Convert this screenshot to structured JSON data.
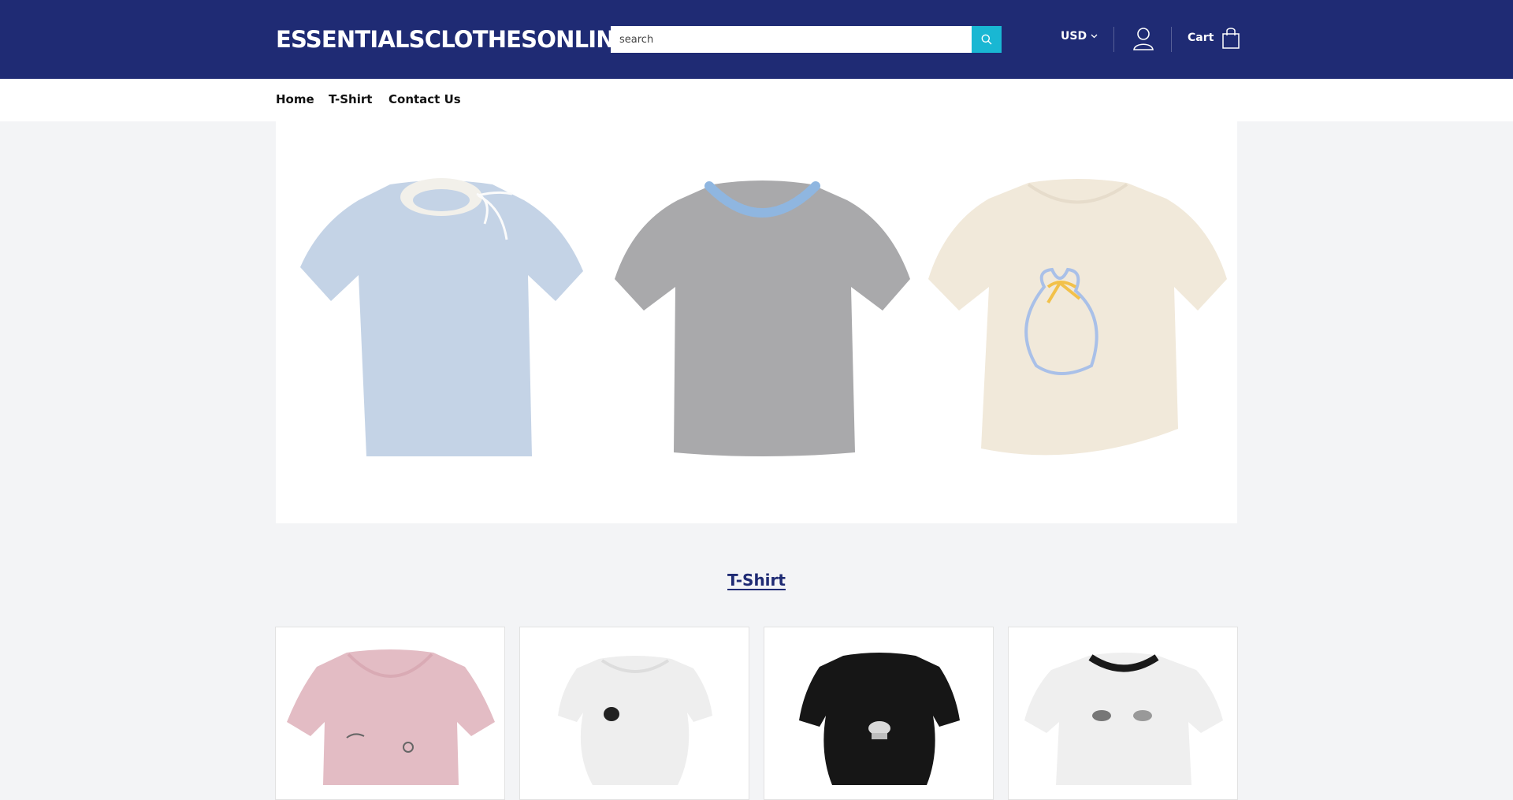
{
  "header": {
    "logo": "ESSENTIALSCLOTHESONLINE",
    "search_placeholder": "search",
    "search_icon": "search-icon",
    "currency": "USD",
    "account_icon": "user-icon",
    "cart_label": "Cart",
    "cart_icon": "shopping-bag-icon",
    "background_color": "#1f2b74",
    "search_button_color": "#19b7d3"
  },
  "nav": {
    "items": [
      {
        "label": "Home"
      },
      {
        "label": "T-Shirt"
      },
      {
        "label": "Contact Us"
      }
    ]
  },
  "hero": {
    "products": [
      {
        "image": "light blue t-shirt with white ribbed collar and bow"
      },
      {
        "image": "grey t-shirt with blue ruffled collar"
      },
      {
        "image": "cream speckled t-shirt with embroidered drawstring bag motif"
      }
    ]
  },
  "collection": {
    "title": "T-Shirt",
    "products": [
      {
        "image": "pink t-shirt with small prints"
      },
      {
        "image": "white t-shirt with black cat print"
      },
      {
        "image": "black t-shirt with cake print"
      },
      {
        "image": "white ringer t-shirt with black trim and cat prints"
      }
    ]
  }
}
